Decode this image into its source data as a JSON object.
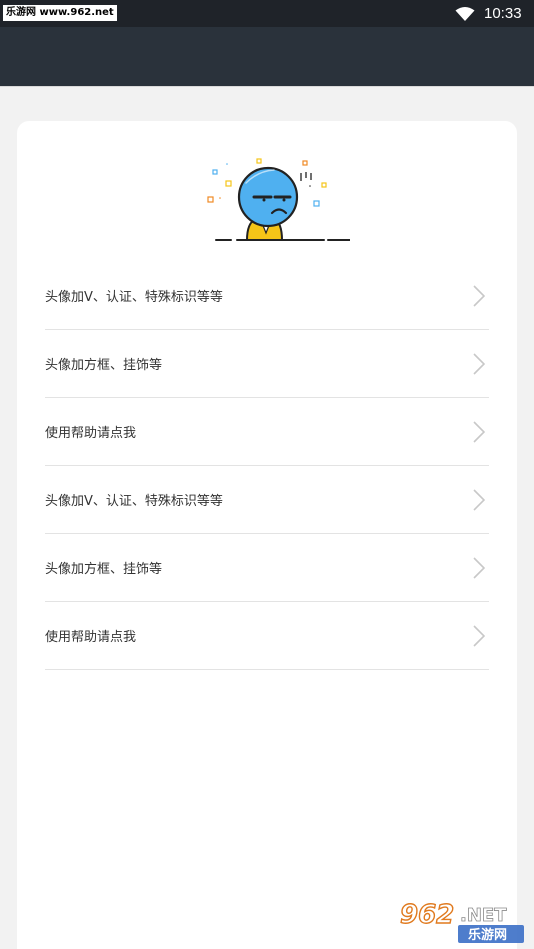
{
  "status_bar": {
    "watermark": "乐游网 www.962.net",
    "time": "10:33"
  },
  "menu": {
    "items": [
      {
        "label": "头像加V、认证、特殊标识等等"
      },
      {
        "label": "头像加方框、挂饰等"
      },
      {
        "label": "使用帮助请点我"
      },
      {
        "label": "头像加V、认证、特殊标识等等"
      },
      {
        "label": "头像加方框、挂饰等"
      },
      {
        "label": "使用帮助请点我"
      }
    ]
  },
  "watermark_bottom": {
    "number": "962",
    "suffix": ".NET",
    "name": "乐游网"
  },
  "colors": {
    "status_bar": "#1f2329",
    "app_bar": "#2a323b",
    "background": "#f2f2f2",
    "card": "#ffffff",
    "text": "#333333",
    "divider": "#e3e3e3",
    "face": "#4fb0f0",
    "body_yellow": "#f5c518"
  },
  "icons": {
    "wifi": "wifi-icon",
    "chevron": "chevron-right-icon",
    "illustration": "sad-face-illustration"
  }
}
